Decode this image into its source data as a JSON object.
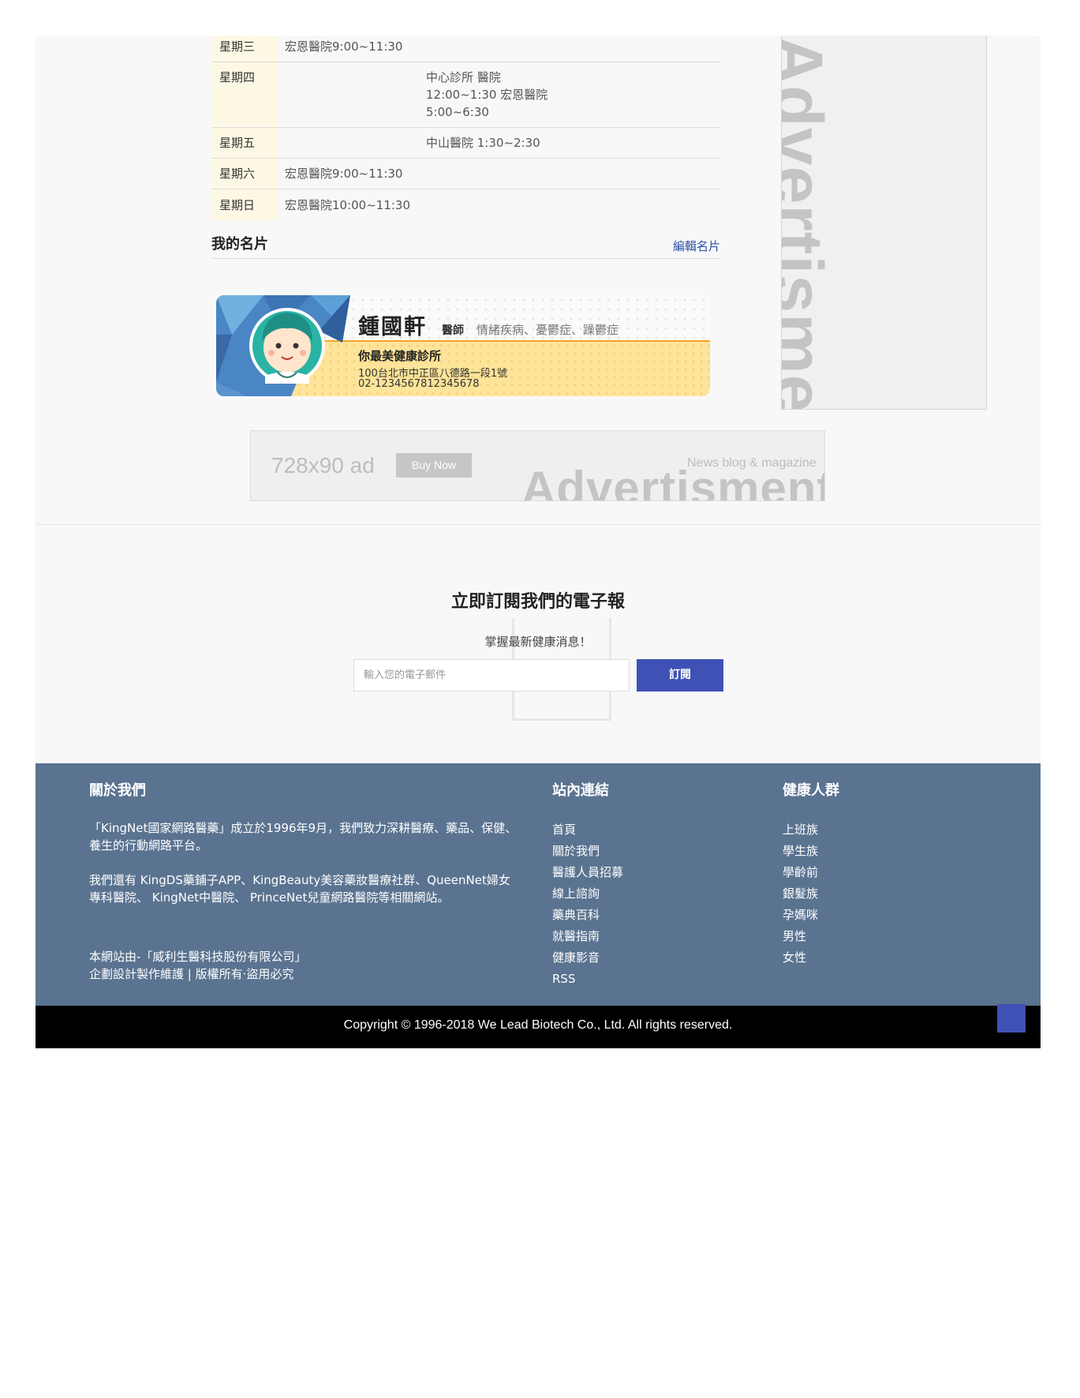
{
  "schedule": [
    {
      "day": "星期三",
      "col1": "宏恩醫院9:00~11:30",
      "col2": []
    },
    {
      "day": "星期四",
      "col1": "",
      "col2": [
        "中心診所 醫院",
        "12:00~1:30 宏恩醫院",
        "5:00~6:30"
      ]
    },
    {
      "day": "星期五",
      "col1": "",
      "col2": [
        "中山醫院 1:30~2:30"
      ]
    },
    {
      "day": "星期六",
      "col1": "宏恩醫院9:00~11:30",
      "col2": []
    },
    {
      "day": "星期日",
      "col1": "宏恩醫院10:00~11:30",
      "col2": []
    }
  ],
  "card_section": {
    "title": "我的名片",
    "edit_link": "編輯名片"
  },
  "name_card": {
    "name": "鍾國軒",
    "role": "醫師",
    "specialties": "情緒疾病、憂鬱症、躁鬱症",
    "clinic": "你最美健康診所",
    "address": "100台北市中正區八德路一段1號",
    "phone": "02-1234567812345678"
  },
  "side_ad": {
    "text": "Advertisment"
  },
  "banner_ad": {
    "size": "728x90 ad",
    "button": "Buy Now",
    "tagline": "News blog & magazine",
    "big": "Advertisment"
  },
  "newsletter": {
    "title": "立即訂閱我們的電子報",
    "subtitle": "掌握最新健康消息！",
    "placeholder": "輸入您的電子郵件",
    "button": "訂閱"
  },
  "footer": {
    "about": {
      "heading": "關於我們",
      "para1": "「KingNet國家網路醫藥」成立於1996年9月，我們致力深耕醫療、藥品、保健、養生的行動網路平台。",
      "para2": "我們還有 KingDS藥鋪子APP、KingBeauty美容藥妝醫療社群、QueenNet婦女專科醫院、 KingNet中醫院、 PrinceNet兒童網路醫院等相關網站。",
      "company_line1": "本網站由-「威利生醫科技股份有限公司」",
      "company_line2": "企劃設計製作維護 | 版權所有‧盜用必究"
    },
    "links": {
      "heading": "站內連結",
      "items": [
        "首頁",
        "關於我們",
        "醫護人員招募",
        "線上諮詢",
        "藥典百科",
        "就醫指南",
        "健康影音",
        "RSS"
      ]
    },
    "groups": {
      "heading": "健康人群",
      "items": [
        "上班族",
        "學生族",
        "學齡前",
        "銀髮族",
        "孕媽咪",
        "男性",
        "女性"
      ]
    }
  },
  "copyright": "Copyright © 1996-2018 We Lead Biotech Co., Ltd. All rights reserved.",
  "colors": {
    "accent": "#3f51b5",
    "footer_bg": "#5a7390",
    "link": "#2d4fa6",
    "day_bg": "#fdf8e4"
  }
}
